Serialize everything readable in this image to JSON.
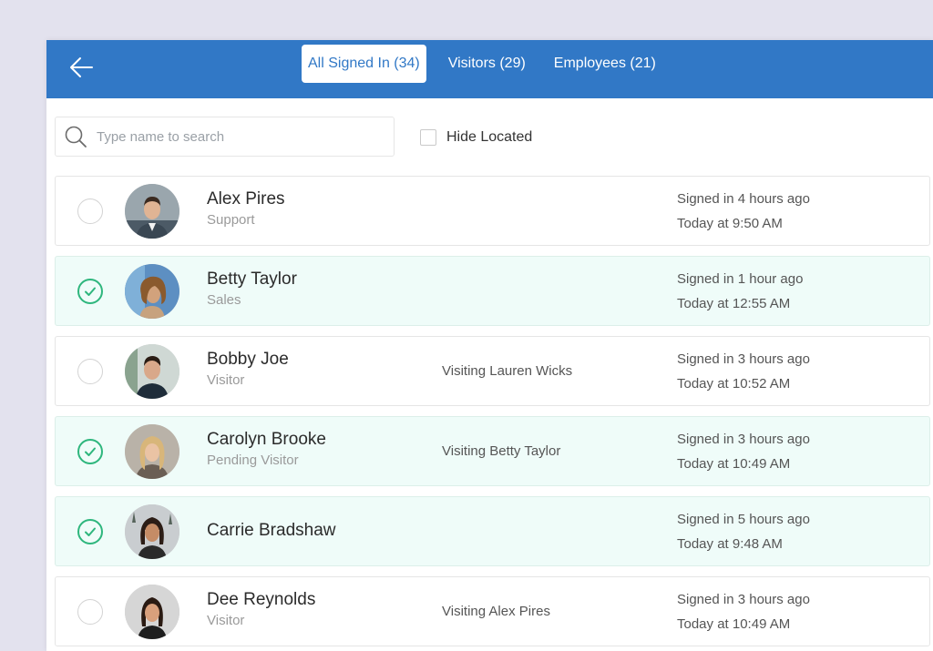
{
  "header": {
    "tabs": [
      {
        "label": "All Signed In (34)",
        "active": true
      },
      {
        "label": "Visitors (29)",
        "active": false
      },
      {
        "label": "Employees (21)",
        "active": false
      }
    ]
  },
  "search": {
    "placeholder": "Type name to search",
    "value": ""
  },
  "filter": {
    "hide_located_label": "Hide Located",
    "checked": false
  },
  "people": [
    {
      "name": "Alex Pires",
      "role": "Support",
      "visiting": "",
      "signed": "Signed in 4 hours ago",
      "time": "Today at 9:50 AM",
      "selected": false
    },
    {
      "name": "Betty Taylor",
      "role": "Sales",
      "visiting": "",
      "signed": "Signed in 1 hour ago",
      "time": "Today at 12:55 AM",
      "selected": true
    },
    {
      "name": "Bobby Joe",
      "role": "Visitor",
      "visiting": "Visiting Lauren Wicks",
      "signed": "Signed in 3 hours ago",
      "time": "Today at 10:52 AM",
      "selected": false
    },
    {
      "name": "Carolyn Brooke",
      "role": "Pending Visitor",
      "visiting": "Visiting Betty Taylor",
      "signed": "Signed in 3 hours ago",
      "time": "Today at 10:49 AM",
      "selected": true
    },
    {
      "name": "Carrie Bradshaw",
      "role": "",
      "visiting": "",
      "signed": "Signed in 5 hours ago",
      "time": "Today at 9:48 AM",
      "selected": true
    },
    {
      "name": "Dee Reynolds",
      "role": "Visitor",
      "visiting": "Visiting Alex Pires",
      "signed": "Signed in 3 hours ago",
      "time": "Today at 10:49 AM",
      "selected": false
    }
  ],
  "colors": {
    "header": "#3178c6",
    "selected_row": "#effcf9",
    "check": "#2eb67d",
    "background": "#e3e2ee"
  }
}
